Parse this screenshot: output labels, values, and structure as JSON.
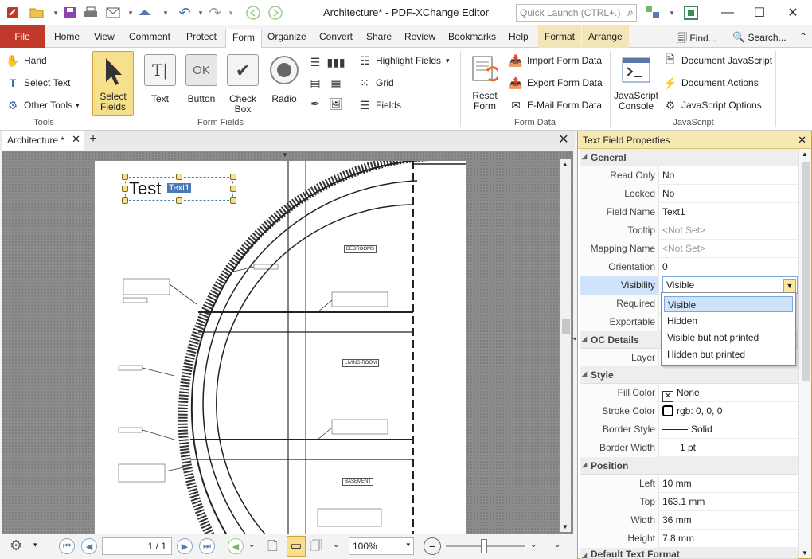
{
  "window": {
    "title": "Architecture* - PDF-XChange Editor",
    "quick_launch_placeholder": "Quick Launch (CTRL+.)",
    "minimize": "—",
    "maximize": "☐",
    "close": "✕"
  },
  "tabs": {
    "file": "File",
    "home": "Home",
    "view": "View",
    "comment": "Comment",
    "protect": "Protect",
    "form": "Form",
    "organize": "Organize",
    "convert": "Convert",
    "share": "Share",
    "review": "Review",
    "bookmarks": "Bookmarks",
    "help": "Help",
    "format": "Format",
    "arrange": "Arrange",
    "find": "Find...",
    "search": "Search..."
  },
  "ribbon": {
    "tools_group": "Tools",
    "hand": "Hand",
    "select_text": "Select Text",
    "other_tools": "Other Tools",
    "select_fields": "Select Fields",
    "text": "Text",
    "button": "Button",
    "check_box": "Check Box",
    "radio": "Radio",
    "form_fields_group": "Form Fields",
    "highlight_fields": "Highlight Fields",
    "grid": "Grid",
    "fields": "Fields",
    "reset_form": "Reset Form",
    "import_form_data": "Import Form Data",
    "export_form_data": "Export Form Data",
    "email_form_data": "E-Mail Form Data",
    "form_data_group": "Form Data",
    "javascript_console": "JavaScript Console",
    "document_javascript": "Document JavaScript",
    "document_actions": "Document Actions",
    "javascript_options": "JavaScript Options",
    "javascript_group": "JavaScript",
    "button_icon_text": "OK"
  },
  "document": {
    "tab_title": "Architecture *",
    "field_text": "Test",
    "field_name_tag": "Text1",
    "labels": {
      "bedrooms": "BEDROOMS",
      "living_room": "LIVING ROOM",
      "basement": "BASEMENT"
    }
  },
  "statusbar": {
    "page": "1 / 1",
    "zoom": "100%"
  },
  "panel": {
    "title": "Text Field Properties",
    "sections": {
      "general": "General",
      "oc_details": "OC Details",
      "style": "Style",
      "position": "Position",
      "default_text_format": "Default Text Format"
    },
    "rows": {
      "read_only": {
        "label": "Read Only",
        "value": "No"
      },
      "locked": {
        "label": "Locked",
        "value": "No"
      },
      "field_name": {
        "label": "Field Name",
        "value": "Text1"
      },
      "tooltip": {
        "label": "Tooltip",
        "value": "<Not Set>"
      },
      "mapping_name": {
        "label": "Mapping Name",
        "value": "<Not Set>"
      },
      "orientation": {
        "label": "Orientation",
        "value": "0"
      },
      "visibility": {
        "label": "Visibility",
        "value": "Visible"
      },
      "required": {
        "label": "Required",
        "value": ""
      },
      "exportable": {
        "label": "Exportable",
        "value": ""
      },
      "layer": {
        "label": "Layer",
        "value": ""
      },
      "fill_color": {
        "label": "Fill Color",
        "value": "None"
      },
      "stroke_color": {
        "label": "Stroke Color",
        "value": "rgb: 0, 0, 0"
      },
      "border_style": {
        "label": "Border Style",
        "value": "Solid"
      },
      "border_width": {
        "label": "Border Width",
        "value": "1 pt"
      },
      "left": {
        "label": "Left",
        "value": "10 mm"
      },
      "top": {
        "label": "Top",
        "value": "163.1 mm"
      },
      "width": {
        "label": "Width",
        "value": "36 mm"
      },
      "height": {
        "label": "Height",
        "value": "7.8 mm"
      }
    },
    "visibility_options": [
      "Visible",
      "Hidden",
      "Visible but not printed",
      "Hidden but printed"
    ]
  },
  "colors": {
    "file_tab": "#c0392b",
    "context_tab": "#f0e6b8",
    "panel_header": "#f6e8b1",
    "selection": "#cfe3fb"
  }
}
